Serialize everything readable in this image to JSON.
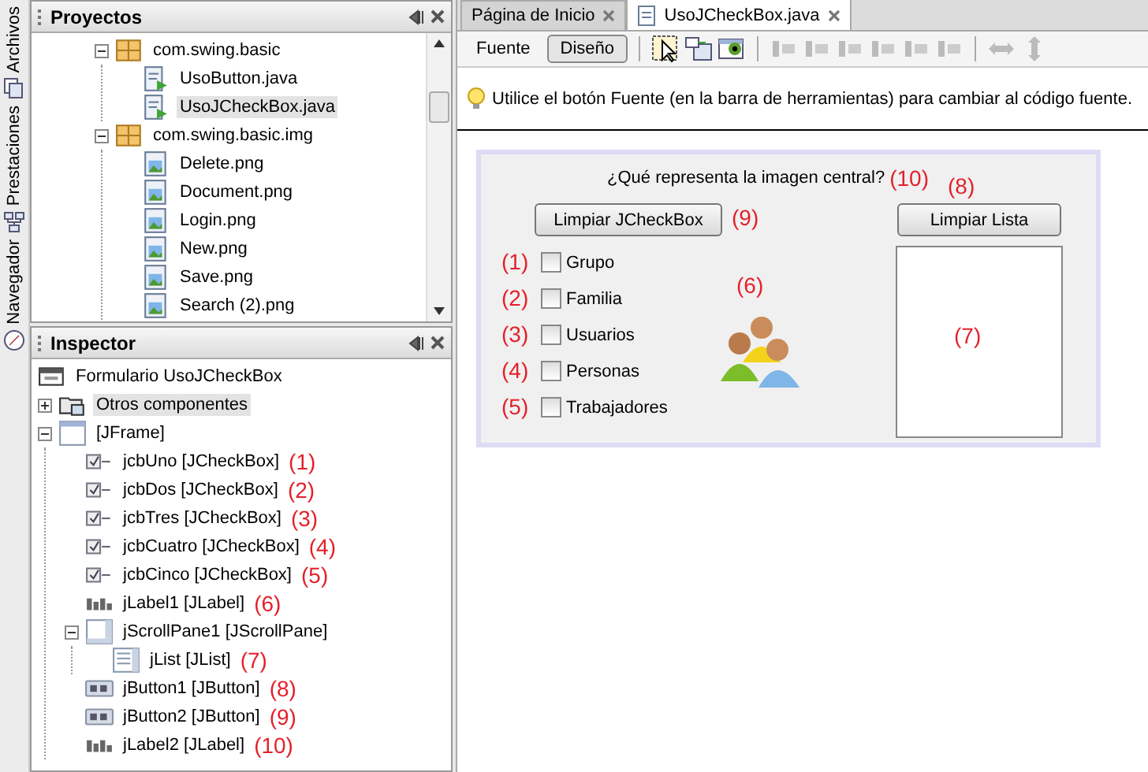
{
  "side_tabs": [
    {
      "label": "Archivos",
      "kind": "files"
    },
    {
      "label": "Prestaciones",
      "kind": "services"
    },
    {
      "label": "Navegador",
      "kind": "navigator"
    }
  ],
  "projects": {
    "title": "Proyectos",
    "tree": [
      {
        "label": "com.swing.basic",
        "kind": "package",
        "expanded": true,
        "selected": false,
        "children": [
          {
            "label": "UsoButton.java",
            "kind": "java",
            "selected": false
          },
          {
            "label": "UsoJCheckBox.java",
            "kind": "java",
            "selected": true
          }
        ]
      },
      {
        "label": "com.swing.basic.img",
        "kind": "package",
        "expanded": true,
        "selected": false,
        "children": [
          {
            "label": "Delete.png",
            "kind": "image",
            "selected": false
          },
          {
            "label": "Document.png",
            "kind": "image",
            "selected": false
          },
          {
            "label": "Login.png",
            "kind": "image",
            "selected": false
          },
          {
            "label": "New.png",
            "kind": "image",
            "selected": false
          },
          {
            "label": "Save.png",
            "kind": "image",
            "selected": false
          },
          {
            "label": "Search (2).png",
            "kind": "image",
            "selected": false
          }
        ]
      }
    ]
  },
  "inspector": {
    "title": "Inspector",
    "root": {
      "label": "Formulario UsoJCheckBox",
      "kind": "form"
    },
    "tree": [
      {
        "label": "Otros componentes",
        "kind": "other",
        "expanded": false,
        "selected": true
      },
      {
        "label": "[JFrame]",
        "kind": "frame",
        "expanded": true,
        "selected": false,
        "children": [
          {
            "label": "jcbUno [JCheckBox]",
            "kind": "checkbox",
            "note": "(1)",
            "selected": false
          },
          {
            "label": "jcbDos [JCheckBox]",
            "kind": "checkbox",
            "note": "(2)",
            "selected": false
          },
          {
            "label": "jcbTres [JCheckBox]",
            "kind": "checkbox",
            "note": "(3)",
            "selected": false
          },
          {
            "label": "jcbCuatro [JCheckBox]",
            "kind": "checkbox",
            "note": "(4)",
            "selected": false
          },
          {
            "label": "jcbCinco [JCheckBox]",
            "kind": "checkbox",
            "note": "(5)",
            "selected": false
          },
          {
            "label": "jLabel1 [JLabel]",
            "kind": "label",
            "note": "(6)",
            "selected": false
          },
          {
            "label": "jScrollPane1 [JScrollPane]",
            "kind": "scrollpane",
            "expanded": true,
            "selected": false,
            "children": [
              {
                "label": "jList [JList]",
                "kind": "list",
                "note": "(7)",
                "selected": false
              }
            ]
          },
          {
            "label": "jButton1 [JButton]",
            "kind": "button",
            "note": "(8)",
            "selected": false
          },
          {
            "label": "jButton2 [JButton]",
            "kind": "button",
            "note": "(9)",
            "selected": false
          },
          {
            "label": "jLabel2 [JLabel]",
            "kind": "label",
            "note": "(10)",
            "selected": false
          }
        ]
      }
    ]
  },
  "editor": {
    "tabs": [
      {
        "label": "Página de Inicio",
        "selected": false,
        "kind": "start"
      },
      {
        "label": "UsoJCheckBox.java",
        "selected": true,
        "kind": "file"
      }
    ],
    "view_buttons": [
      {
        "label": "Fuente",
        "selected": false
      },
      {
        "label": "Diseño",
        "selected": true
      }
    ],
    "hint": "Utilice el botón Fuente (en la barra de herramientas) para cambiar al código fuente.",
    "form": {
      "question": {
        "text": "¿Qué representa la imagen central?",
        "note": "(10)"
      },
      "clear_checkboxes_button": {
        "label": "Limpiar JCheckBox",
        "note": "(9)"
      },
      "clear_list_button": {
        "label": "Limpiar Lista",
        "note": "(8)"
      },
      "checkboxes": [
        {
          "label": "Grupo",
          "checked": false,
          "note": "(1)"
        },
        {
          "label": "Familia",
          "checked": false,
          "note": "(2)"
        },
        {
          "label": "Usuarios",
          "checked": false,
          "note": "(3)"
        },
        {
          "label": "Personas",
          "checked": false,
          "note": "(4)"
        },
        {
          "label": "Trabajadores",
          "checked": false,
          "note": "(5)"
        }
      ],
      "image": {
        "note": "(6)"
      },
      "list": {
        "note": "(7)"
      }
    }
  }
}
